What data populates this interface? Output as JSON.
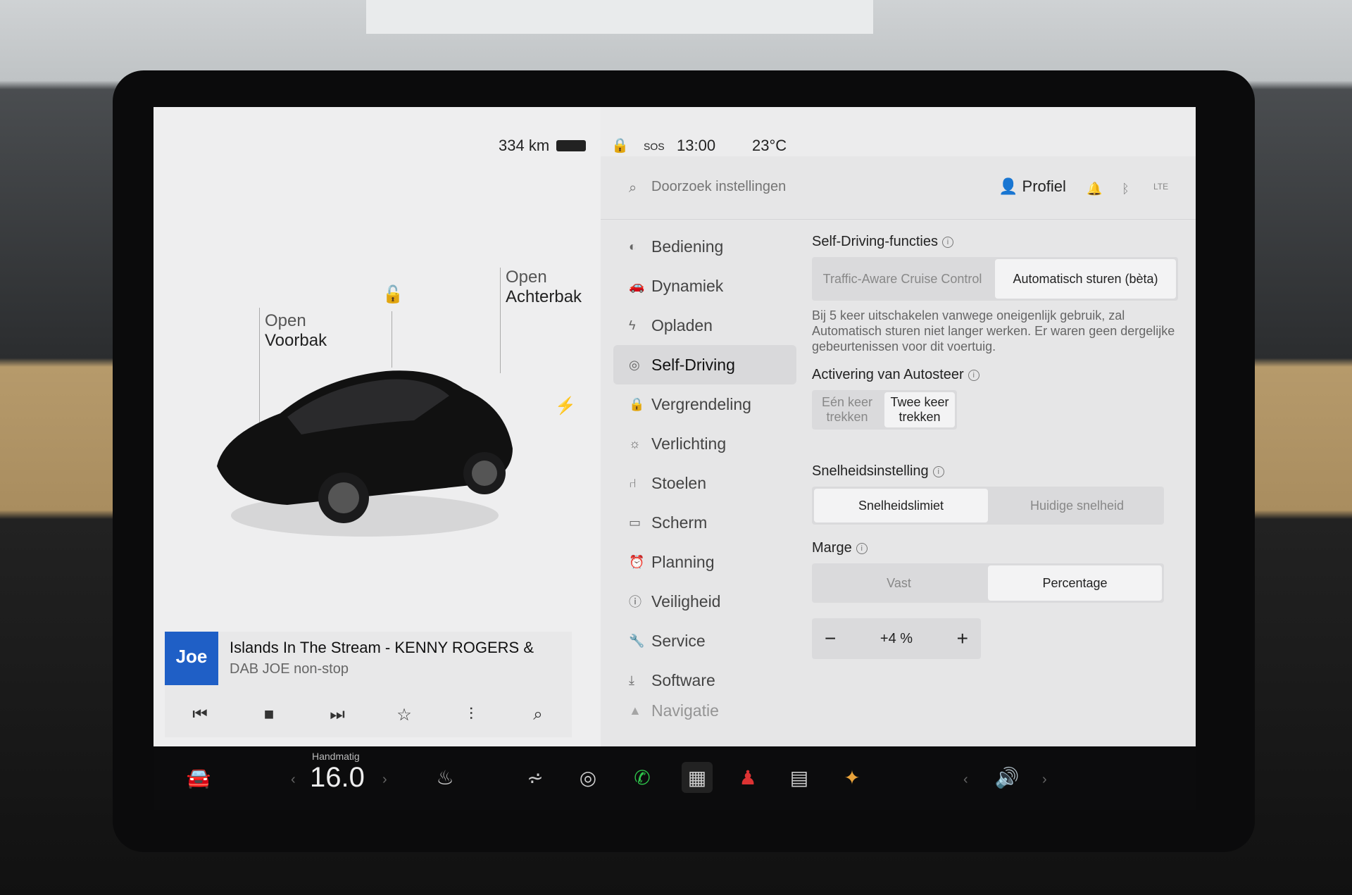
{
  "status": {
    "range": "334 km",
    "sos": "SOS",
    "time": "13:00",
    "temperature": "23°C"
  },
  "car_panel": {
    "frunk": {
      "top": "Open",
      "bottom": "Voorbak"
    },
    "trunk": {
      "top": "Open",
      "bottom": "Achterbak"
    }
  },
  "media": {
    "station_logo": "Joe",
    "title": "Islands In The Stream - KENNY ROGERS &",
    "subtitle": "DAB JOE non-stop",
    "controls": [
      "skip-back-icon",
      "stop-icon",
      "skip-forward-icon",
      "star-icon",
      "equalizer-icon",
      "search-icon"
    ]
  },
  "search": {
    "placeholder": "Doorzoek instellingen"
  },
  "header": {
    "profile_label": "Profiel",
    "lte_label": "LTE"
  },
  "menu": {
    "items": [
      {
        "label": "Bediening",
        "icon": "toggle-icon"
      },
      {
        "label": "Dynamiek",
        "icon": "car-icon"
      },
      {
        "label": "Opladen",
        "icon": "bolt-icon"
      },
      {
        "label": "Self-Driving",
        "icon": "steering-wheel-icon",
        "active": true
      },
      {
        "label": "Vergrendeling",
        "icon": "lock-icon"
      },
      {
        "label": "Verlichting",
        "icon": "sun-icon"
      },
      {
        "label": "Stoelen",
        "icon": "seat-icon"
      },
      {
        "label": "Scherm",
        "icon": "screen-icon"
      },
      {
        "label": "Planning",
        "icon": "clock-icon"
      },
      {
        "label": "Veiligheid",
        "icon": "info-icon"
      },
      {
        "label": "Service",
        "icon": "wrench-icon"
      },
      {
        "label": "Software",
        "icon": "download-icon"
      },
      {
        "label": "Navigatie",
        "icon": "navigation-icon"
      }
    ]
  },
  "settings": {
    "self_driving": {
      "title": "Self-Driving-functies",
      "options": [
        "Traffic-Aware Cruise Control",
        "Automatisch sturen (bèta)"
      ],
      "selected": "Automatisch sturen (bèta)",
      "description": "Bij 5 keer uitschakelen vanwege oneigenlijk gebruik, zal Automatisch sturen niet langer werken. Er waren geen dergelijke gebeurtenissen voor dit voertuig."
    },
    "autosteer": {
      "title": "Activering van Autosteer",
      "options": [
        "Eén keer trekken",
        "Twee keer trekken"
      ],
      "selected": "Twee keer trekken"
    },
    "speed": {
      "title": "Snelheidsinstelling",
      "options": [
        "Snelheidslimiet",
        "Huidige snelheid"
      ],
      "selected": "Snelheidslimiet"
    },
    "margin": {
      "title": "Marge",
      "options": [
        "Vast",
        "Percentage"
      ],
      "selected": "Percentage",
      "value": "+4 %",
      "minus": "−",
      "plus": "+"
    }
  },
  "dock": {
    "climate_mode": "Handmatig",
    "climate_temp": "16.0",
    "items": [
      "car-icon",
      "seat-heater-icon",
      "rear-defrost-icon",
      "steering-heat-icon",
      "phone-icon",
      "apps-icon",
      "joystick-icon",
      "calendar-icon",
      "games-icon",
      "volume-icon"
    ]
  },
  "colors": {
    "accent_blue": "#1f5fc6",
    "phone_green": "#2ec44a"
  }
}
